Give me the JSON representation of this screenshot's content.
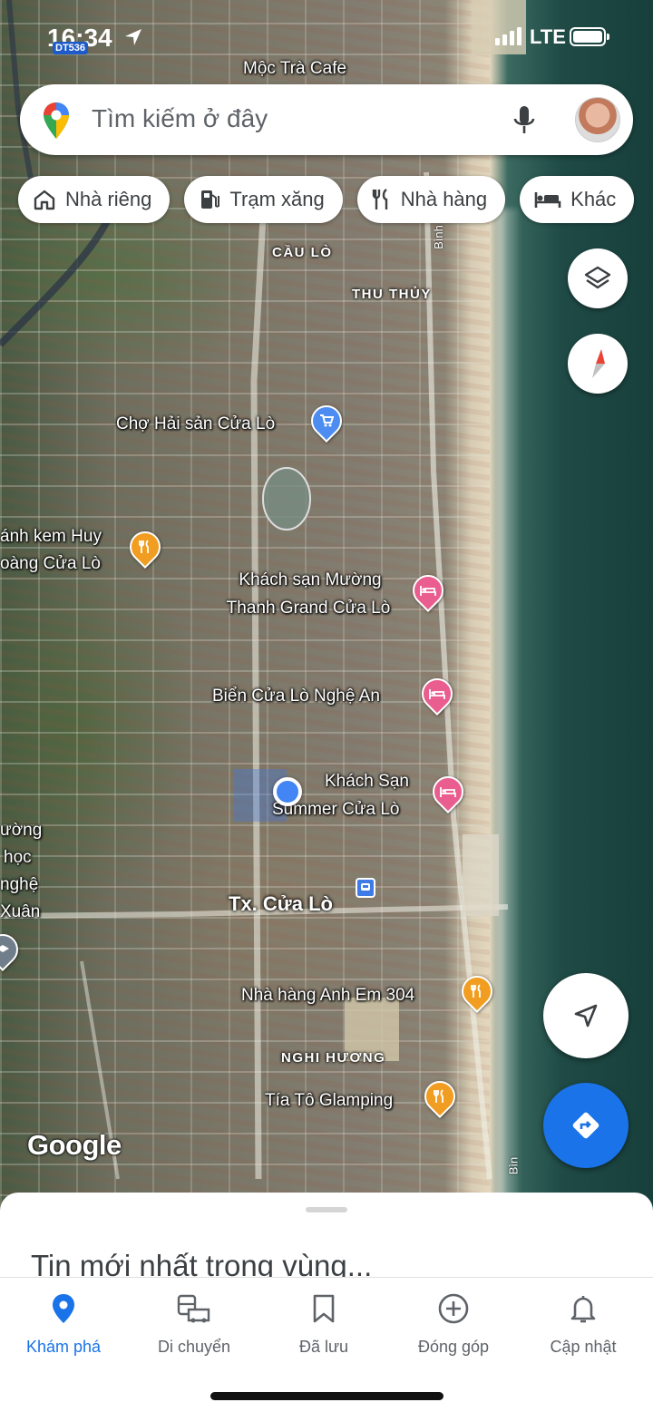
{
  "status_bar": {
    "time": "16:34",
    "badge": "DT536",
    "network": "LTE",
    "signal_bars": 4,
    "battery_fraction": 1.0
  },
  "search": {
    "placeholder": "Tìm kiếm ở đây",
    "mic_icon": "mic-icon",
    "avatar_icon": "profile-avatar"
  },
  "chips": [
    {
      "label": "Nhà riêng",
      "icon": "home-icon"
    },
    {
      "label": "Trạm xăng",
      "icon": "gas-station-icon"
    },
    {
      "label": "Nhà hàng",
      "icon": "restaurant-icon"
    },
    {
      "label": "Khác",
      "icon": "hotel-bed-icon"
    }
  ],
  "map": {
    "attribution": "Google",
    "labels": {
      "moc_tra_cafe": "Mộc Trà Cafe",
      "cau_lo": "CẦU LÒ",
      "thu_thuy": "THU THỦY",
      "cho_hai_san": "Chợ Hải sản Cửa Lò",
      "banh_kem_line1": "ánh kem Huy",
      "banh_kem_line2": "oàng Cửa Lò",
      "khach_san_muong_line1": "Khách sạn Mường",
      "khach_san_muong_line2": "Thanh Grand Cửa Lò",
      "bien_cua_lo": "Biển Cửa Lò Nghệ An",
      "summer_line1": "Khách Sạn",
      "summer_line2": "Summer Cửa Lò",
      "school_line1": "ường",
      "school_line2": "học",
      "school_line3": "nghệ",
      "school_line4": "Xuân",
      "tx_cua_lo": "Tx. Cửa Lò",
      "nha_hang_anh_em": "Nhà hàng Anh Em 304",
      "nghi_huong": "NGHI HƯƠNG",
      "tia_to": "Tía Tô Glamping",
      "road_binh_top": "Bình",
      "road_binh_bottom": "Bìn"
    },
    "colors": {
      "food_pin": "#f09d21",
      "hotel_pin": "#e95d8f",
      "shop_pin": "#4d8df2",
      "my_location": "#4285f4",
      "directions_fab": "#1a73e8"
    }
  },
  "controls": {
    "layers_icon": "layers-icon",
    "compass_icon": "compass-icon",
    "my_location_icon": "navigation-arrow-icon",
    "directions_icon": "directions-icon"
  },
  "sheet": {
    "title": "Tin mới nhất trong vùng..."
  },
  "nav": [
    {
      "label": "Khám phá",
      "icon": "explore-pin-icon",
      "active": true
    },
    {
      "label": "Di chuyển",
      "icon": "commute-icon",
      "active": false
    },
    {
      "label": "Đã lưu",
      "icon": "bookmark-icon",
      "active": false
    },
    {
      "label": "Đóng góp",
      "icon": "add-circle-icon",
      "active": false
    },
    {
      "label": "Cập nhật",
      "icon": "bell-icon",
      "active": false
    }
  ]
}
